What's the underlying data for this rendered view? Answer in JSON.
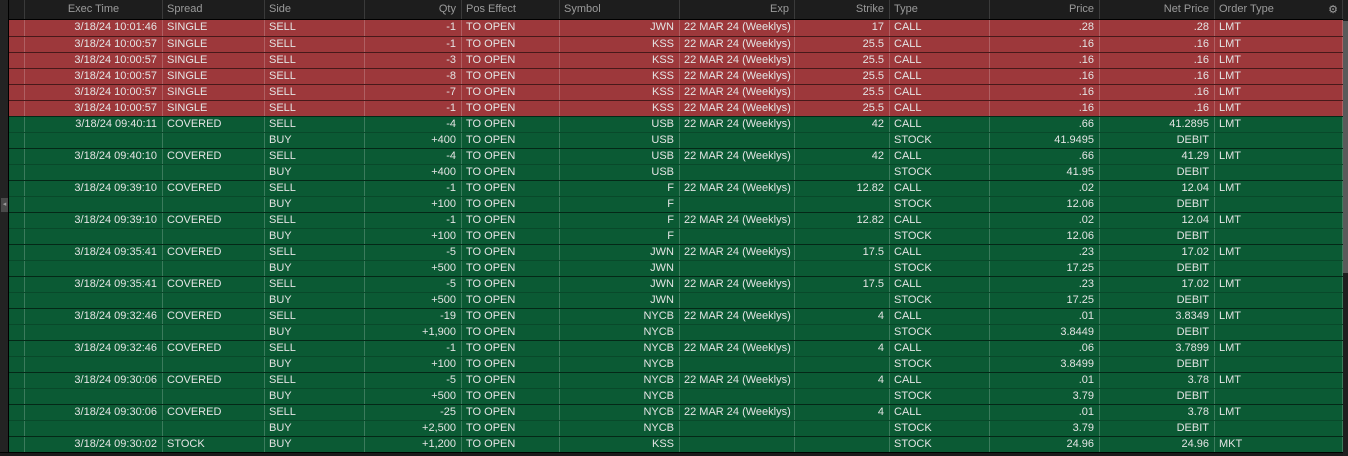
{
  "header": {
    "columns": [
      "",
      "Exec Time",
      "Spread",
      "Side",
      "Qty",
      "Pos Effect",
      "Symbol",
      "Exp",
      "Strike",
      "Type",
      "Price",
      "Net Price",
      "Order Type"
    ],
    "gear_icon": "⚙"
  },
  "colors": {
    "sell_row": "#9d383b",
    "buy_row": "#0b5a34",
    "header_bg": "#1d1d1d",
    "text": "#e4e4e4"
  },
  "rows": [
    {
      "color": "red",
      "lines": [
        [
          "3/18/24 10:01:46",
          "SINGLE",
          "SELL",
          "-1",
          "TO OPEN",
          "JWN",
          "22 MAR 24 (Weeklys)",
          "17",
          "CALL",
          ".28",
          ".28",
          "LMT"
        ]
      ]
    },
    {
      "color": "red",
      "lines": [
        [
          "3/18/24 10:00:57",
          "SINGLE",
          "SELL",
          "-1",
          "TO OPEN",
          "KSS",
          "22 MAR 24 (Weeklys)",
          "25.5",
          "CALL",
          ".16",
          ".16",
          "LMT"
        ]
      ]
    },
    {
      "color": "red",
      "lines": [
        [
          "3/18/24 10:00:57",
          "SINGLE",
          "SELL",
          "-3",
          "TO OPEN",
          "KSS",
          "22 MAR 24 (Weeklys)",
          "25.5",
          "CALL",
          ".16",
          ".16",
          "LMT"
        ]
      ]
    },
    {
      "color": "red",
      "lines": [
        [
          "3/18/24 10:00:57",
          "SINGLE",
          "SELL",
          "-8",
          "TO OPEN",
          "KSS",
          "22 MAR 24 (Weeklys)",
          "25.5",
          "CALL",
          ".16",
          ".16",
          "LMT"
        ]
      ]
    },
    {
      "color": "red",
      "lines": [
        [
          "3/18/24 10:00:57",
          "SINGLE",
          "SELL",
          "-7",
          "TO OPEN",
          "KSS",
          "22 MAR 24 (Weeklys)",
          "25.5",
          "CALL",
          ".16",
          ".16",
          "LMT"
        ]
      ]
    },
    {
      "color": "red",
      "lines": [
        [
          "3/18/24 10:00:57",
          "SINGLE",
          "SELL",
          "-1",
          "TO OPEN",
          "KSS",
          "22 MAR 24 (Weeklys)",
          "25.5",
          "CALL",
          ".16",
          ".16",
          "LMT"
        ]
      ]
    },
    {
      "color": "green",
      "lines": [
        [
          "3/18/24 09:40:11",
          "COVERED",
          "SELL",
          "-4",
          "TO OPEN",
          "USB",
          "22 MAR 24 (Weeklys)",
          "42",
          "CALL",
          ".66",
          "41.2895",
          "LMT"
        ],
        [
          "",
          "",
          "BUY",
          "+400",
          "TO OPEN",
          "USB",
          "",
          "",
          "STOCK",
          "41.9495",
          "DEBIT",
          ""
        ]
      ]
    },
    {
      "color": "green",
      "lines": [
        [
          "3/18/24 09:40:10",
          "COVERED",
          "SELL",
          "-4",
          "TO OPEN",
          "USB",
          "22 MAR 24 (Weeklys)",
          "42",
          "CALL",
          ".66",
          "41.29",
          "LMT"
        ],
        [
          "",
          "",
          "BUY",
          "+400",
          "TO OPEN",
          "USB",
          "",
          "",
          "STOCK",
          "41.95",
          "DEBIT",
          ""
        ]
      ]
    },
    {
      "color": "green",
      "lines": [
        [
          "3/18/24 09:39:10",
          "COVERED",
          "SELL",
          "-1",
          "TO OPEN",
          "F",
          "22 MAR 24 (Weeklys)",
          "12.82",
          "CALL",
          ".02",
          "12.04",
          "LMT"
        ],
        [
          "",
          "",
          "BUY",
          "+100",
          "TO OPEN",
          "F",
          "",
          "",
          "STOCK",
          "12.06",
          "DEBIT",
          ""
        ]
      ]
    },
    {
      "color": "green",
      "lines": [
        [
          "3/18/24 09:39:10",
          "COVERED",
          "SELL",
          "-1",
          "TO OPEN",
          "F",
          "22 MAR 24 (Weeklys)",
          "12.82",
          "CALL",
          ".02",
          "12.04",
          "LMT"
        ],
        [
          "",
          "",
          "BUY",
          "+100",
          "TO OPEN",
          "F",
          "",
          "",
          "STOCK",
          "12.06",
          "DEBIT",
          ""
        ]
      ]
    },
    {
      "color": "green",
      "lines": [
        [
          "3/18/24 09:35:41",
          "COVERED",
          "SELL",
          "-5",
          "TO OPEN",
          "JWN",
          "22 MAR 24 (Weeklys)",
          "17.5",
          "CALL",
          ".23",
          "17.02",
          "LMT"
        ],
        [
          "",
          "",
          "BUY",
          "+500",
          "TO OPEN",
          "JWN",
          "",
          "",
          "STOCK",
          "17.25",
          "DEBIT",
          ""
        ]
      ]
    },
    {
      "color": "green",
      "lines": [
        [
          "3/18/24 09:35:41",
          "COVERED",
          "SELL",
          "-5",
          "TO OPEN",
          "JWN",
          "22 MAR 24 (Weeklys)",
          "17.5",
          "CALL",
          ".23",
          "17.02",
          "LMT"
        ],
        [
          "",
          "",
          "BUY",
          "+500",
          "TO OPEN",
          "JWN",
          "",
          "",
          "STOCK",
          "17.25",
          "DEBIT",
          ""
        ]
      ]
    },
    {
      "color": "green",
      "lines": [
        [
          "3/18/24 09:32:46",
          "COVERED",
          "SELL",
          "-19",
          "TO OPEN",
          "NYCB",
          "22 MAR 24 (Weeklys)",
          "4",
          "CALL",
          ".01",
          "3.8349",
          "LMT"
        ],
        [
          "",
          "",
          "BUY",
          "+1,900",
          "TO OPEN",
          "NYCB",
          "",
          "",
          "STOCK",
          "3.8449",
          "DEBIT",
          ""
        ]
      ]
    },
    {
      "color": "green",
      "lines": [
        [
          "3/18/24 09:32:46",
          "COVERED",
          "SELL",
          "-1",
          "TO OPEN",
          "NYCB",
          "22 MAR 24 (Weeklys)",
          "4",
          "CALL",
          ".06",
          "3.7899",
          "LMT"
        ],
        [
          "",
          "",
          "BUY",
          "+100",
          "TO OPEN",
          "NYCB",
          "",
          "",
          "STOCK",
          "3.8499",
          "DEBIT",
          ""
        ]
      ]
    },
    {
      "color": "green",
      "lines": [
        [
          "3/18/24 09:30:06",
          "COVERED",
          "SELL",
          "-5",
          "TO OPEN",
          "NYCB",
          "22 MAR 24 (Weeklys)",
          "4",
          "CALL",
          ".01",
          "3.78",
          "LMT"
        ],
        [
          "",
          "",
          "BUY",
          "+500",
          "TO OPEN",
          "NYCB",
          "",
          "",
          "STOCK",
          "3.79",
          "DEBIT",
          ""
        ]
      ]
    },
    {
      "color": "green",
      "lines": [
        [
          "3/18/24 09:30:06",
          "COVERED",
          "SELL",
          "-25",
          "TO OPEN",
          "NYCB",
          "22 MAR 24 (Weeklys)",
          "4",
          "CALL",
          ".01",
          "3.78",
          "LMT"
        ],
        [
          "",
          "",
          "BUY",
          "+2,500",
          "TO OPEN",
          "NYCB",
          "",
          "",
          "STOCK",
          "3.79",
          "DEBIT",
          ""
        ]
      ]
    },
    {
      "color": "green",
      "lines": [
        [
          "3/18/24 09:30:02",
          "STOCK",
          "BUY",
          "+1,200",
          "TO OPEN",
          "KSS",
          "",
          "",
          "STOCK",
          "24.96",
          "24.96",
          "MKT"
        ]
      ]
    }
  ]
}
